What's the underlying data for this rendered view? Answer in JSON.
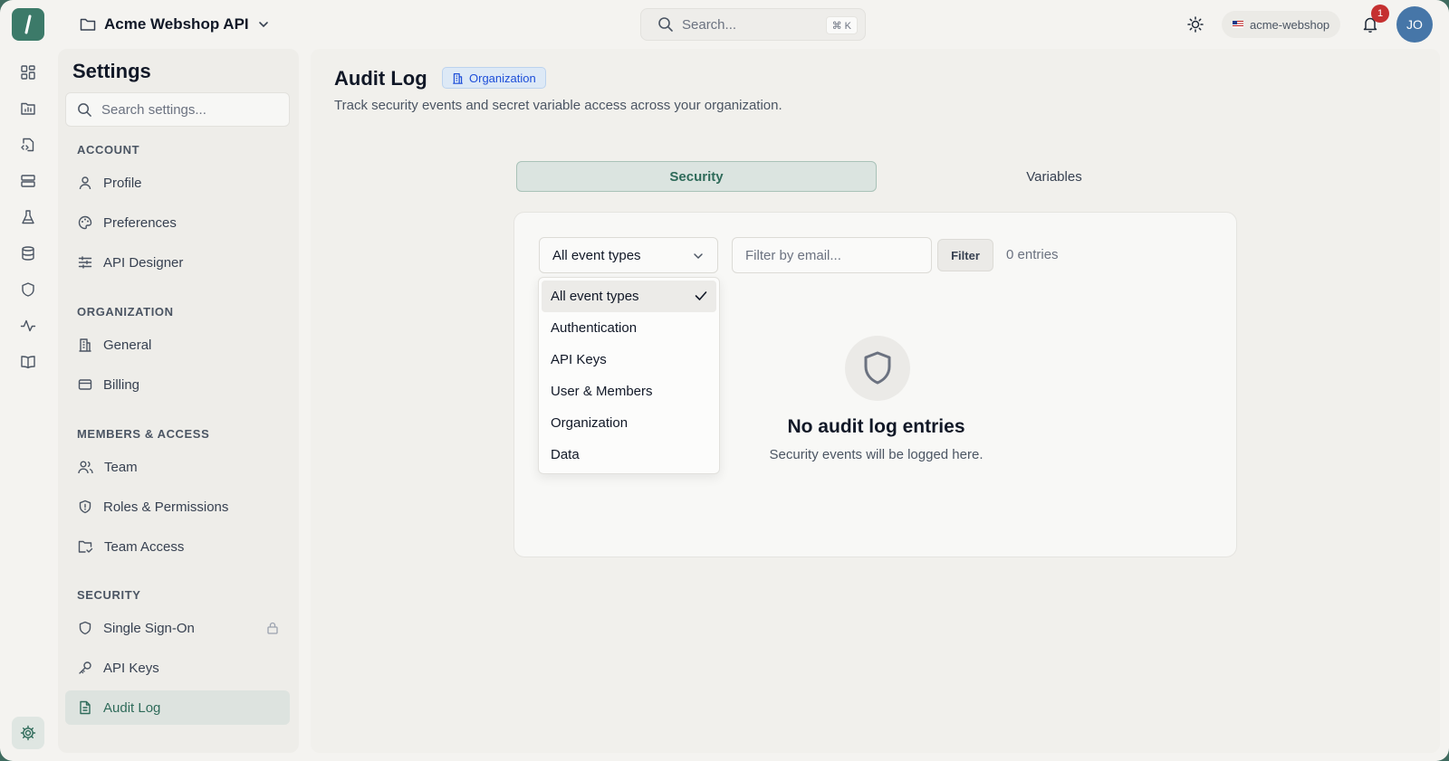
{
  "app": {
    "project_name": "Acme Webshop API",
    "search_placeholder": "Search...",
    "search_shortcut": "⌘ K",
    "workspace": "acme-webshop",
    "notifications_count": "1",
    "avatar_initials": "JO"
  },
  "rail": {
    "icons": [
      "dashboard-icon",
      "folder-chart-icon",
      "code-file-icon",
      "server-icon",
      "flask-icon",
      "database-icon",
      "shield-icon",
      "activity-icon",
      "book-icon"
    ],
    "settings_icon": "gear-icon"
  },
  "settings": {
    "title": "Settings",
    "search_placeholder": "Search settings...",
    "sections": {
      "account": {
        "label": "ACCOUNT",
        "items": [
          {
            "label": "Profile",
            "icon": "user-icon"
          },
          {
            "label": "Preferences",
            "icon": "palette-icon"
          },
          {
            "label": "API Designer",
            "icon": "sliders-icon"
          }
        ]
      },
      "organization": {
        "label": "ORGANIZATION",
        "items": [
          {
            "label": "General",
            "icon": "building-icon"
          },
          {
            "label": "Billing",
            "icon": "credit-card-icon"
          }
        ]
      },
      "members": {
        "label": "MEMBERS & ACCESS",
        "items": [
          {
            "label": "Team",
            "icon": "users-icon"
          },
          {
            "label": "Roles & Permissions",
            "icon": "shield-icon"
          },
          {
            "label": "Team Access",
            "icon": "folder-check-icon"
          }
        ]
      },
      "security": {
        "label": "SECURITY",
        "items": [
          {
            "label": "Single Sign-On",
            "icon": "shield-icon",
            "locked": true
          },
          {
            "label": "API Keys",
            "icon": "key-icon"
          },
          {
            "label": "Audit Log",
            "icon": "document-icon",
            "active": true
          }
        ]
      }
    }
  },
  "main": {
    "title": "Audit Log",
    "badge": "Organization",
    "subtitle": "Track security events and secret variable access across your organization.",
    "tabs": [
      {
        "label": "Security",
        "active": true
      },
      {
        "label": "Variables",
        "active": false
      }
    ],
    "filters": {
      "event_type_selected": "All event types",
      "email_placeholder": "Filter by email...",
      "filter_button": "Filter",
      "entries_text": "0 entries"
    },
    "dropdown_options": [
      "All event types",
      "Authentication",
      "API Keys",
      "User & Members",
      "Organization",
      "Data"
    ],
    "empty": {
      "title": "No audit log entries",
      "subtitle": "Security events will be logged here."
    }
  },
  "colors": {
    "accent": "#3c7a69",
    "badge_bg": "#dde9f6",
    "notification": "#c53030",
    "avatar": "#4676a8"
  }
}
